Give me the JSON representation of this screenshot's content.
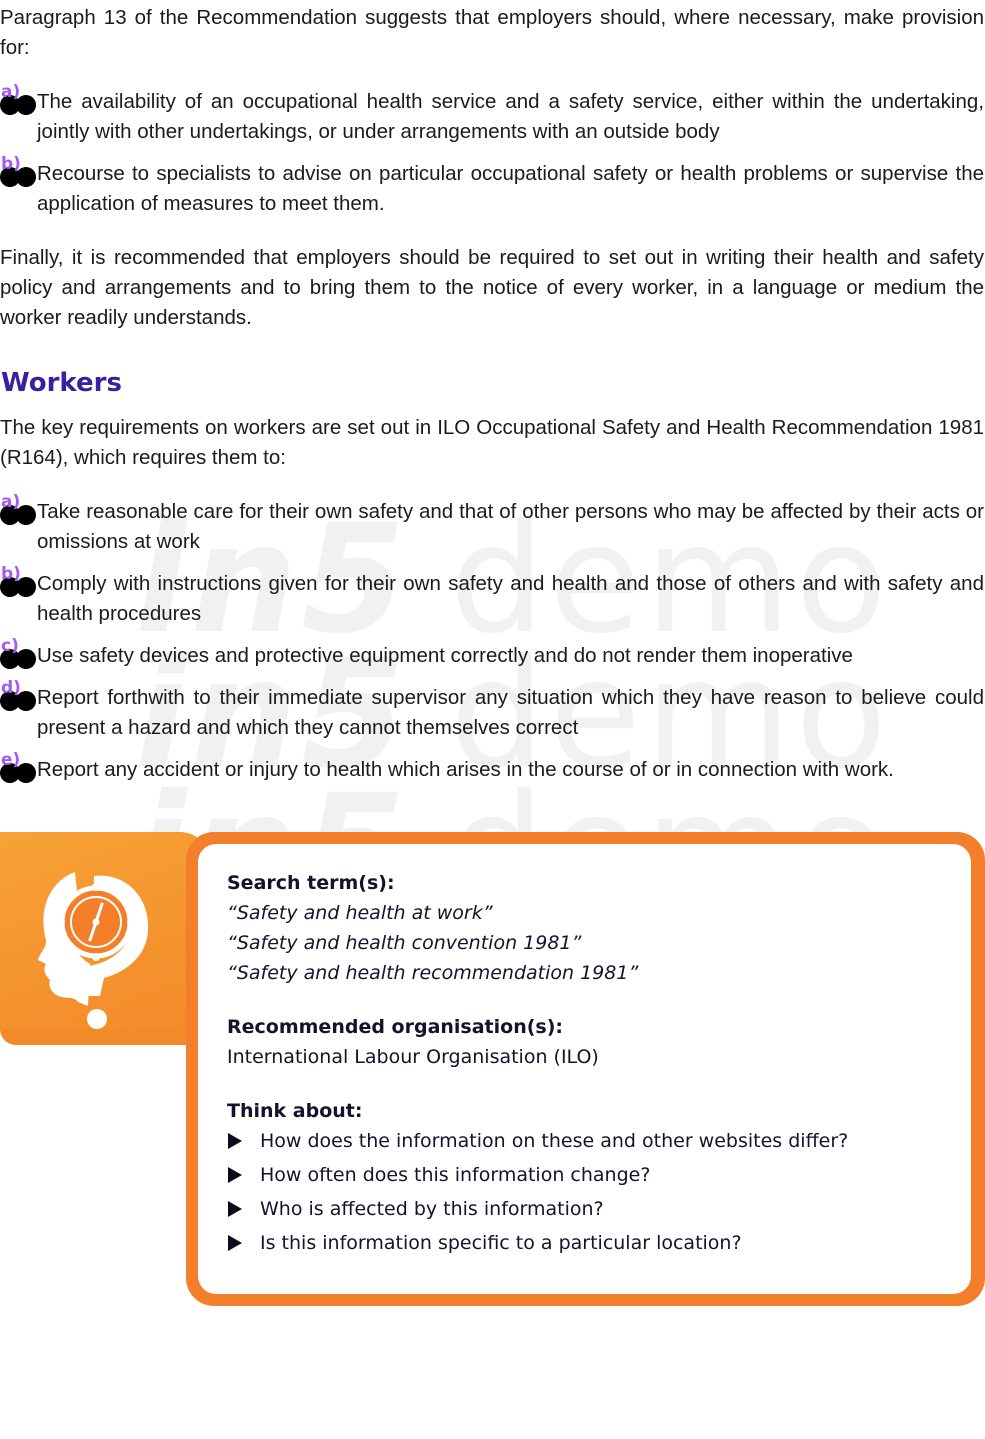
{
  "intro_paragraph": "Paragraph 13 of the Recommendation suggests that employers should, where necessary, make provision for:",
  "employer_items": [
    {
      "marker": "a)",
      "text": "The availability of an occupational health service and a safety service, either within the undertaking, jointly with other undertakings, or under arrangements with an outside body"
    },
    {
      "marker": "b)",
      "text": "Recourse to specialists to advise on particular occupational safety or health problems or supervise the application of measures to meet them."
    }
  ],
  "finally_paragraph": "Finally, it is recommended that employers should be required to set out in writing their health and safety policy and arrangements and to bring them to the notice of every worker, in a language or medium the worker readily understands.",
  "workers_heading": "Workers",
  "workers_intro": "The key requirements on workers are set out in ILO Occupational Safety and Health Recommendation 1981 (R164), which requires them to:",
  "worker_items": [
    {
      "marker": "a)",
      "text": "Take reasonable care for their own safety and that of other persons who may be affected by their acts or omissions at work"
    },
    {
      "marker": "b)",
      "text": "Comply with instructions given for their own safety and health and those of others and with safety and health procedures"
    },
    {
      "marker": "c)",
      "text": "Use safety devices and protective equipment correctly and do not render them inoperative"
    },
    {
      "marker": "d)",
      "text": "Report forthwith to their immediate supervisor any situation which they have reason to believe could present a hazard and which they cannot themselves correct"
    },
    {
      "marker": "e)",
      "text": "Report any accident or injury to health which arises in the course of or in connection with work."
    }
  ],
  "watermark": {
    "brand": "in5",
    "word": "demo"
  },
  "info_box": {
    "icon": "head-clock-question-icon",
    "search_label": "Search term(s):",
    "search_terms": [
      "“Safety and health at work”",
      "“Safety and health convention 1981”",
      "“Safety and health recommendation 1981”"
    ],
    "org_label": "Recommended organisation(s):",
    "org_value": "International Labour Organisation (ILO)",
    "think_label": "Think about:",
    "think_items": [
      "How does the information on these and other websites differ?",
      "How often does this information change?",
      "Who is affected by this information?",
      "Is this information specific to a particular location?"
    ]
  },
  "colors": {
    "heading": "#3b1fa0",
    "marker_label": "#a35bf0",
    "box_orange": "#f47f2b",
    "tab_orange": "#f7a236"
  }
}
